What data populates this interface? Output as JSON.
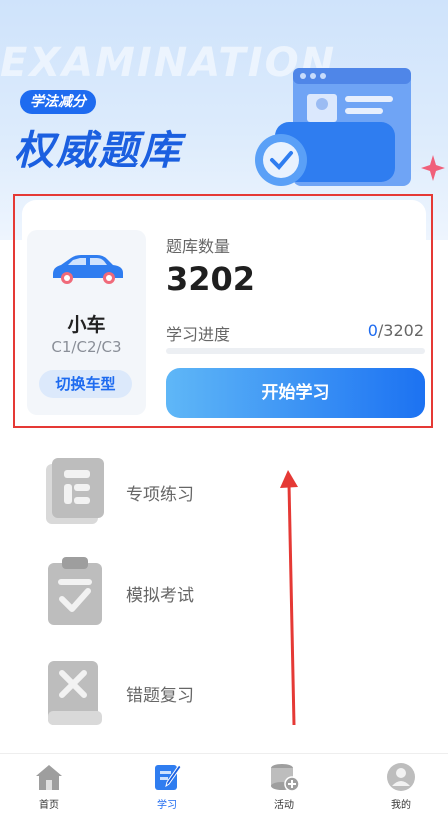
{
  "hero": {
    "watermark": "EXAMINATION",
    "badge": "学法减分",
    "title": "权威题库"
  },
  "vehicle": {
    "name": "小车",
    "license_types": "C1/C2/C3",
    "switch_label": "切换车型"
  },
  "stats": {
    "count_label": "题库数量",
    "count": "3202",
    "progress_label": "学习进度",
    "progress_current": "0",
    "progress_total": "/3202",
    "progress_fraction": 0,
    "start_label": "开始学习"
  },
  "menu": [
    {
      "label": "专项练习",
      "icon": "book-list-icon"
    },
    {
      "label": "模拟考试",
      "icon": "clipboard-check-icon"
    },
    {
      "label": "错题复习",
      "icon": "book-x-icon"
    }
  ],
  "tabbar": [
    {
      "label": "首页",
      "icon": "home-icon"
    },
    {
      "label": "学习",
      "icon": "notebook-pen-icon",
      "active": true
    },
    {
      "label": "活动",
      "icon": "coins-icon"
    },
    {
      "label": "我的",
      "icon": "user-icon"
    }
  ],
  "colors": {
    "accent": "#1e6bf0",
    "highlight_box": "#e53935"
  }
}
